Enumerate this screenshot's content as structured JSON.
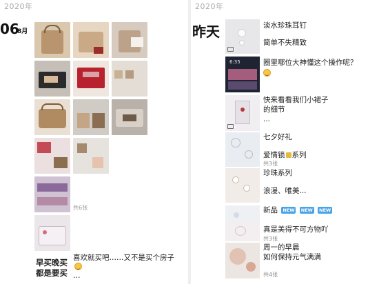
{
  "left": {
    "year": "2020年",
    "date_day": "06",
    "date_month": "8月",
    "album_count": "共6张",
    "post2_caption": "喜欢就买吧……又不是买个房子",
    "post2_handwritten_line1": "早买晚买",
    "post2_handwritten_line2": "都是要买",
    "post2_ellipsis": "…"
  },
  "right": {
    "year": "2020年",
    "yesterday": "昨天",
    "posts": [
      {
        "line1": "淡水珍珠耳钉",
        "line2": "简单不失精致"
      },
      {
        "line1": "圈里哪位大神懂这个操作呢？"
      },
      {
        "line1": "快来看看我们小裙子",
        "line2": "的细节",
        "line3": "..."
      },
      {
        "line1": "七夕好礼",
        "line2": "爱情锁",
        "line2b": "系列",
        "count": "共3张"
      },
      {
        "line1": "珍珠系列",
        "line2": "浪漫、唯美..."
      },
      {
        "line1": "新品",
        "badge": "NEW"
      },
      {
        "line1": "真是美得不可方物吖",
        "count": "共3张"
      },
      {
        "line1": "周一的早晨",
        "line2": "如何保持元气满满",
        "count": "共4张"
      }
    ]
  },
  "colors": {
    "background": "#ffffff",
    "year_text": "#aaaaaa",
    "count_text": "#999999",
    "new_badge": "#4aa3e6"
  },
  "icons": {
    "video": "video-camera-icon",
    "lock": "lock-emoji-icon",
    "emoji": "smiling-face-icon"
  }
}
